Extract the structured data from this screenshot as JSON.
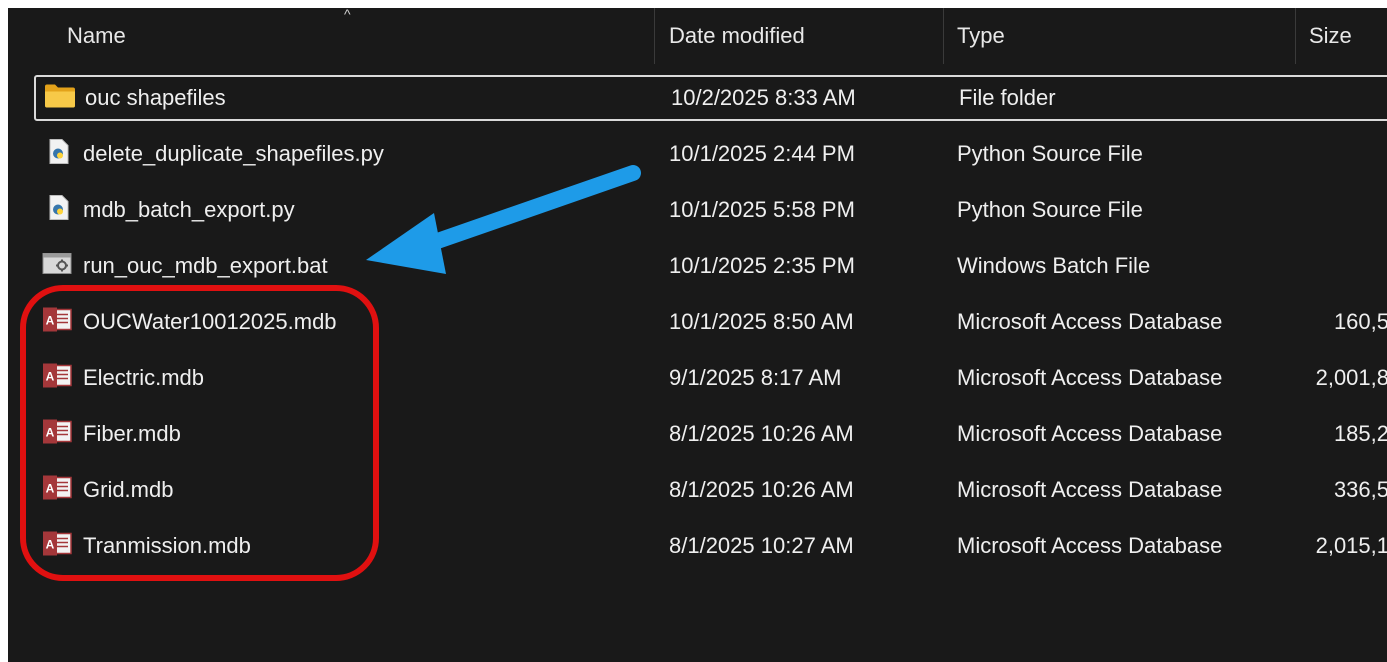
{
  "header": {
    "name": "Name",
    "date_modified": "Date modified",
    "type": "Type",
    "size": "Size"
  },
  "sort_indicator": "^",
  "files": [
    {
      "name": "ouc shapefiles",
      "date": "10/2/2025 8:33 AM",
      "type": "File folder",
      "size": "",
      "icon": "folder-icon"
    },
    {
      "name": "delete_duplicate_shapefiles.py",
      "date": "10/1/2025 2:44 PM",
      "type": "Python Source File",
      "size": "",
      "icon": "python-file-icon"
    },
    {
      "name": "mdb_batch_export.py",
      "date": "10/1/2025 5:58 PM",
      "type": "Python Source File",
      "size": "",
      "icon": "python-file-icon"
    },
    {
      "name": "run_ouc_mdb_export.bat",
      "date": "10/1/2025 2:35 PM",
      "type": "Windows Batch File",
      "size": "",
      "icon": "batch-file-icon"
    },
    {
      "name": "OUCWater10012025.mdb",
      "date": "10/1/2025 8:50 AM",
      "type": "Microsoft Access Database",
      "size": "160,5",
      "icon": "access-db-icon"
    },
    {
      "name": "Electric.mdb",
      "date": "9/1/2025 8:17 AM",
      "type": "Microsoft Access Database",
      "size": "2,001,8",
      "icon": "access-db-icon"
    },
    {
      "name": "Fiber.mdb",
      "date": "8/1/2025 10:26 AM",
      "type": "Microsoft Access Database",
      "size": "185,2",
      "icon": "access-db-icon"
    },
    {
      "name": "Grid.mdb",
      "date": "8/1/2025 10:26 AM",
      "type": "Microsoft Access Database",
      "size": "336,5",
      "icon": "access-db-icon"
    },
    {
      "name": "Tranmission.mdb",
      "date": "8/1/2025 10:27 AM",
      "type": "Microsoft Access Database",
      "size": "2,015,1",
      "icon": "access-db-icon"
    }
  ],
  "annotations": {
    "arrow_color": "#1e9be8",
    "highlight_color": "#e01010"
  }
}
